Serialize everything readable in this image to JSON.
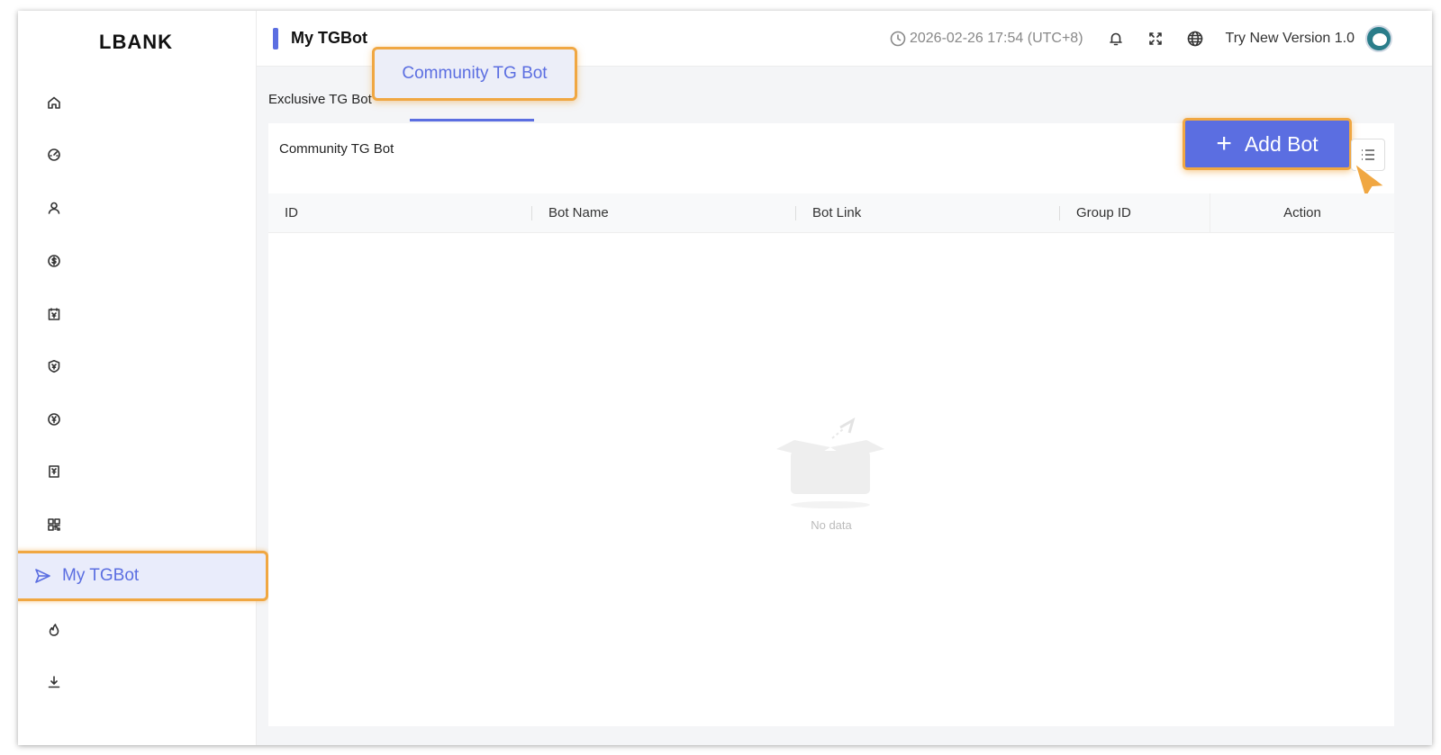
{
  "app": {
    "logo": "LBANK"
  },
  "header": {
    "title": "My TGBot",
    "datetime": "2026-02-26 17:54 (UTC+8)",
    "try_new": "Try New Version 1.0"
  },
  "sidebar": {
    "icons": [
      "home-icon",
      "dashboard-icon",
      "user-icon",
      "dollar-icon",
      "calendar-icon",
      "shield-icon",
      "yen-icon",
      "document-icon",
      "qrcode-icon",
      "fire-icon",
      "download-icon"
    ],
    "active_label": "My TGBot",
    "active_icon": "send-icon"
  },
  "tabs": {
    "exclusive": "Exclusive TG Bot",
    "community": "Community TG Bot"
  },
  "panel": {
    "title": "Community TG Bot",
    "add_button": "Add Bot",
    "columns": [
      "ID",
      "Bot Name",
      "Bot Link",
      "Group ID",
      "Action"
    ],
    "empty_text": "No data"
  },
  "colors": {
    "accent": "#5b6ee1",
    "highlight": "#f0a742"
  }
}
